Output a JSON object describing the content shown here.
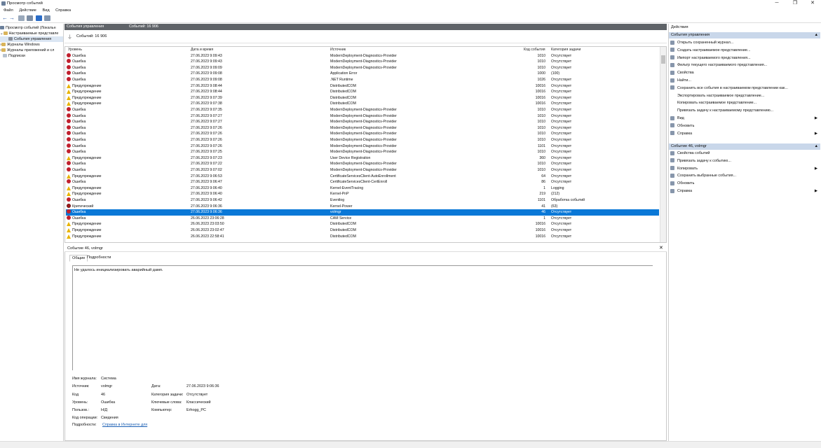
{
  "window": {
    "title": "Просмотр событий",
    "min": "─",
    "max": "❐",
    "close": "✕"
  },
  "menu": [
    "Файл",
    "Действие",
    "Вид",
    "Справка"
  ],
  "tree": {
    "root": "Просмотр событий (Локальн",
    "custom": "Настраиваемые представле",
    "admin": "События управления",
    "windows": "Журналы Windows",
    "apps": "Журналы приложений и сл",
    "subs": "Подписки"
  },
  "header": {
    "title": "События управления",
    "count": "Событий: 16 906"
  },
  "filter": {
    "label": "Событий: 16 906"
  },
  "columns": {
    "level": "Уровень",
    "date": "Дата и время",
    "source": "Источник",
    "code": "Код события",
    "cat": "Категория задачи"
  },
  "rows": [
    {
      "t": "err",
      "level": "Ошибка",
      "date": "27.06.2023 9:09:43",
      "source": "ModernDeployment-Diagnostics-Provider",
      "code": "1010",
      "cat": "Отсутствует"
    },
    {
      "t": "err",
      "level": "Ошибка",
      "date": "27.06.2023 9:09:43",
      "source": "ModernDeployment-Diagnostics-Provider",
      "code": "1010",
      "cat": "Отсутствует"
    },
    {
      "t": "err",
      "level": "Ошибка",
      "date": "27.06.2023 9:09:09",
      "source": "ModernDeployment-Diagnostics-Provider",
      "code": "1010",
      "cat": "Отсутствует"
    },
    {
      "t": "err",
      "level": "Ошибка",
      "date": "27.06.2023 9:09:08",
      "source": "Application Error",
      "code": "1000",
      "cat": "(100)"
    },
    {
      "t": "err",
      "level": "Ошибка",
      "date": "27.06.2023 9:09:08",
      "source": ".NET Runtime",
      "code": "1026",
      "cat": "Отсутствует"
    },
    {
      "t": "warn",
      "level": "Предупреждение",
      "date": "27.06.2023 9:08:44",
      "source": "DistributedCOM",
      "code": "10016",
      "cat": "Отсутствует"
    },
    {
      "t": "warn",
      "level": "Предупреждение",
      "date": "27.06.2023 9:08:44",
      "source": "DistributedCOM",
      "code": "10016",
      "cat": "Отсутствует"
    },
    {
      "t": "warn",
      "level": "Предупреждение",
      "date": "27.06.2023 9:07:39",
      "source": "DistributedCOM",
      "code": "10016",
      "cat": "Отсутствует"
    },
    {
      "t": "warn",
      "level": "Предупреждение",
      "date": "27.06.2023 9:07:38",
      "source": "DistributedCOM",
      "code": "10016",
      "cat": "Отсутствует"
    },
    {
      "t": "err",
      "level": "Ошибка",
      "date": "27.06.2023 9:07:35",
      "source": "ModernDeployment-Diagnostics-Provider",
      "code": "1010",
      "cat": "Отсутствует"
    },
    {
      "t": "err",
      "level": "Ошибка",
      "date": "27.06.2023 9:07:27",
      "source": "ModernDeployment-Diagnostics-Provider",
      "code": "1010",
      "cat": "Отсутствует"
    },
    {
      "t": "err",
      "level": "Ошибка",
      "date": "27.06.2023 9:07:27",
      "source": "ModernDeployment-Diagnostics-Provider",
      "code": "1010",
      "cat": "Отсутствует"
    },
    {
      "t": "err",
      "level": "Ошибка",
      "date": "27.06.2023 9:07:26",
      "source": "ModernDeployment-Diagnostics-Provider",
      "code": "1010",
      "cat": "Отсутствует"
    },
    {
      "t": "err",
      "level": "Ошибка",
      "date": "27.06.2023 9:07:26",
      "source": "ModernDeployment-Diagnostics-Provider",
      "code": "1010",
      "cat": "Отсутствует"
    },
    {
      "t": "err",
      "level": "Ошибка",
      "date": "27.06.2023 9:07:26",
      "source": "ModernDeployment-Diagnostics-Provider",
      "code": "1010",
      "cat": "Отсутствует"
    },
    {
      "t": "err",
      "level": "Ошибка",
      "date": "27.06.2023 9:07:26",
      "source": "ModernDeployment-Diagnostics-Provider",
      "code": "1101",
      "cat": "Отсутствует"
    },
    {
      "t": "err",
      "level": "Ошибка",
      "date": "27.06.2023 9:07:25",
      "source": "ModernDeployment-Diagnostics-Provider",
      "code": "1010",
      "cat": "Отсутствует"
    },
    {
      "t": "warn",
      "level": "Предупреждение",
      "date": "27.06.2023 9:07:23",
      "source": "User Device Registration",
      "code": "360",
      "cat": "Отсутствует"
    },
    {
      "t": "err",
      "level": "Ошибка",
      "date": "27.06.2023 9:07:22",
      "source": "ModernDeployment-Diagnostics-Provider",
      "code": "1010",
      "cat": "Отсутствует"
    },
    {
      "t": "err",
      "level": "Ошибка",
      "date": "27.06.2023 9:07:02",
      "source": "ModernDeployment-Diagnostics-Provider",
      "code": "1010",
      "cat": "Отсутствует"
    },
    {
      "t": "warn",
      "level": "Предупреждение",
      "date": "27.06.2023 9:06:53",
      "source": "CertificateServicesClient-AutoEnrollment",
      "code": "64",
      "cat": "Отсутствует"
    },
    {
      "t": "err",
      "level": "Ошибка",
      "date": "27.06.2023 9:06:47",
      "source": "CertificateServicesClient-CertEnroll",
      "code": "86",
      "cat": "Отсутствует"
    },
    {
      "t": "warn",
      "level": "Предупреждение",
      "date": "27.06.2023 9:06:40",
      "source": "Kernel-EventTracing",
      "code": "1",
      "cat": "Logging"
    },
    {
      "t": "warn",
      "level": "Предупреждение",
      "date": "27.06.2023 9:06:40",
      "source": "Kernel-PnP",
      "code": "219",
      "cat": "(212)"
    },
    {
      "t": "err",
      "level": "Ошибка",
      "date": "27.06.2023 9:06:42",
      "source": "Eventlog",
      "code": "1101",
      "cat": "Обработка событий"
    },
    {
      "t": "crit",
      "level": "Критический",
      "date": "27.06.2023 9:06:36",
      "source": "Kernel-Power",
      "code": "41",
      "cat": "(63)"
    },
    {
      "t": "err",
      "level": "Ошибка",
      "date": "27.06.2023 9:06:36",
      "source": "volmgr",
      "code": "46",
      "cat": "Отсутствует",
      "sel": true
    },
    {
      "t": "err",
      "level": "Ошибка",
      "date": "26.06.2023 23:06:28",
      "source": "CAM Service",
      "code": "1",
      "cat": "Отсутствует"
    },
    {
      "t": "warn",
      "level": "Предупреждение",
      "date": "26.06.2023 23:03:50",
      "source": "DistributedCOM",
      "code": "10016",
      "cat": "Отсутствует"
    },
    {
      "t": "warn",
      "level": "Предупреждение",
      "date": "26.06.2023 23:02:47",
      "source": "DistributedCOM",
      "code": "10016",
      "cat": "Отсутствует"
    },
    {
      "t": "warn",
      "level": "Предупреждение",
      "date": "26.06.2023 22:58:41",
      "source": "DistributedCOM",
      "code": "10016",
      "cat": "Отсутствует"
    }
  ],
  "detail": {
    "title": "Событие 46, volmgr",
    "close": "✕",
    "tab_general": "Общие",
    "tab_details": "Подробности",
    "message": "Не удалось инициализировать аварийный дамп.",
    "log_label": "Имя журнала:",
    "log_value": "Система",
    "source_label": "Источник:",
    "source_value": "volmgr",
    "date_label": "Дата:",
    "date_value": "27.06.2023 9:06:36",
    "code_label": "Код",
    "code_value": "46",
    "task_label": "Категория задачи:",
    "task_value": "Отсутствует",
    "level_label": "Уровень:",
    "level_value": "Ошибка",
    "keys_label": "Ключевые слова:",
    "keys_value": "Классический",
    "user_label": "Пользов.:",
    "user_value": "Н/Д",
    "comp_label": "Компьютер:",
    "comp_value": "Erhogg_PC",
    "op_label": "Код операции:",
    "op_value": "Сведения",
    "more_label": "Подробности:",
    "more_link": "Справка в Интернете для"
  },
  "actions": {
    "header": "Действия",
    "sec1": "События управления",
    "items1": [
      {
        "icon": "open-log-icon",
        "label": "Открыть сохраненный журнал...",
        "arrow": ""
      },
      {
        "icon": "create-view-icon",
        "label": "Создать настраиваемое представление...",
        "arrow": ""
      },
      {
        "icon": "import-view-icon",
        "label": "Импорт настраиваемого представления...",
        "arrow": ""
      },
      {
        "icon": "filter-icon",
        "label": "Фильтр текущего настраиваемого представления...",
        "arrow": ""
      },
      {
        "icon": "properties-icon",
        "label": "Свойства",
        "arrow": ""
      },
      {
        "icon": "find-icon",
        "label": "Найти...",
        "arrow": ""
      },
      {
        "icon": "save-icon",
        "label": "Сохранить все события в настраиваемом представлении как...",
        "arrow": ""
      },
      {
        "icon": "blank-icon",
        "label": "Экспортировать настраиваемое представление...",
        "arrow": ""
      },
      {
        "icon": "blank-icon",
        "label": "Копировать настраиваемое представление...",
        "arrow": ""
      },
      {
        "icon": "blank-icon",
        "label": "Привязать задачу к настраиваемому представлению...",
        "arrow": ""
      },
      {
        "icon": "view-icon",
        "label": "Вид",
        "arrow": "▶"
      },
      {
        "icon": "refresh-icon",
        "label": "Обновить",
        "arrow": ""
      },
      {
        "icon": "help-icon",
        "label": "Справка",
        "arrow": "▶"
      }
    ],
    "sec2": "Событие 46, volmgr",
    "items2": [
      {
        "icon": "event-properties-icon",
        "label": "Свойства событий",
        "arrow": ""
      },
      {
        "icon": "attach-task-icon",
        "label": "Привязать задачу к событию...",
        "arrow": ""
      },
      {
        "icon": "copy-icon",
        "label": "Копировать",
        "arrow": "▶"
      },
      {
        "icon": "save-selected-icon",
        "label": "Сохранить выбранные события...",
        "arrow": ""
      },
      {
        "icon": "refresh-icon",
        "label": "Обновить",
        "arrow": ""
      },
      {
        "icon": "help-icon",
        "label": "Справка",
        "arrow": "▶"
      }
    ]
  },
  "colors": {
    "selection": "#0a78d7",
    "error": "#c0202e",
    "warning": "#e8b400",
    "section": "#c9d7ea",
    "header": "#5f6368"
  }
}
